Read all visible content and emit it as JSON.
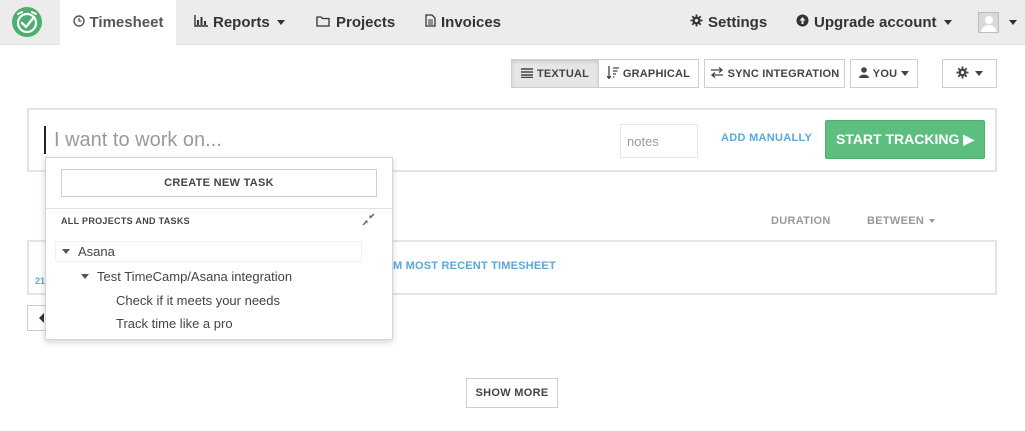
{
  "nav": {
    "items": [
      {
        "label": "Timesheet",
        "icon": "clock-icon",
        "active": true
      },
      {
        "label": "Reports",
        "icon": "bar-chart-icon"
      },
      {
        "label": "Projects",
        "icon": "folder-icon"
      },
      {
        "label": "Invoices",
        "icon": "document-icon"
      }
    ],
    "settings_label": "Settings",
    "upgrade_label": "Upgrade account"
  },
  "toolbar": {
    "textual": "TEXTUAL",
    "graphical": "GRAPHICAL",
    "sync": "SYNC INTEGRATION",
    "you": "YOU"
  },
  "tracker": {
    "task_placeholder": "I want to work on...",
    "notes_placeholder": "notes",
    "add_manually": "ADD MANUALLY",
    "start_label": "START TRACKING ▶"
  },
  "columns": {
    "duration": "DURATION",
    "between": "BETWEEN"
  },
  "entries": {
    "recent_fragment": "M MOST RECENT TIMESHEET",
    "date_fragment": "21"
  },
  "dropdown": {
    "create_task": "CREATE NEW TASK",
    "header": "ALL PROJECTS AND TASKS",
    "tree": [
      {
        "label": "Asana",
        "level": 0,
        "expanded": true
      },
      {
        "label": "Test TimeCamp/Asana integration",
        "level": 1,
        "expanded": true
      },
      {
        "label": "Check if it meets your needs",
        "level": 2
      },
      {
        "label": "Track time like a pro",
        "level": 2
      }
    ]
  },
  "show_more": "SHOW MORE",
  "colors": {
    "brand_green": "#5cbf7f",
    "link_blue": "#5aa7d8",
    "navbar_bg": "#ececec"
  }
}
